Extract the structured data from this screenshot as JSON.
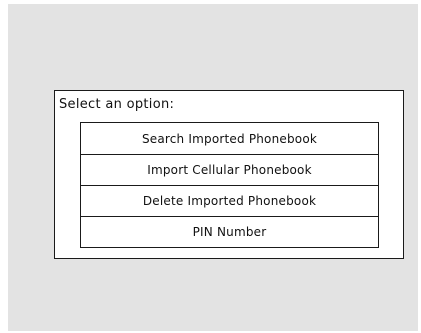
{
  "dialog": {
    "prompt": "Select an option:",
    "options": [
      {
        "label": "Search Imported Phonebook"
      },
      {
        "label": "Import Cellular Phonebook"
      },
      {
        "label": "Delete Imported Phonebook"
      },
      {
        "label": "PIN Number"
      }
    ]
  },
  "colors": {
    "screen_background": "#e3e3e3",
    "dialog_background": "#ffffff",
    "border": "#1a1a1a",
    "text": "#111111"
  }
}
